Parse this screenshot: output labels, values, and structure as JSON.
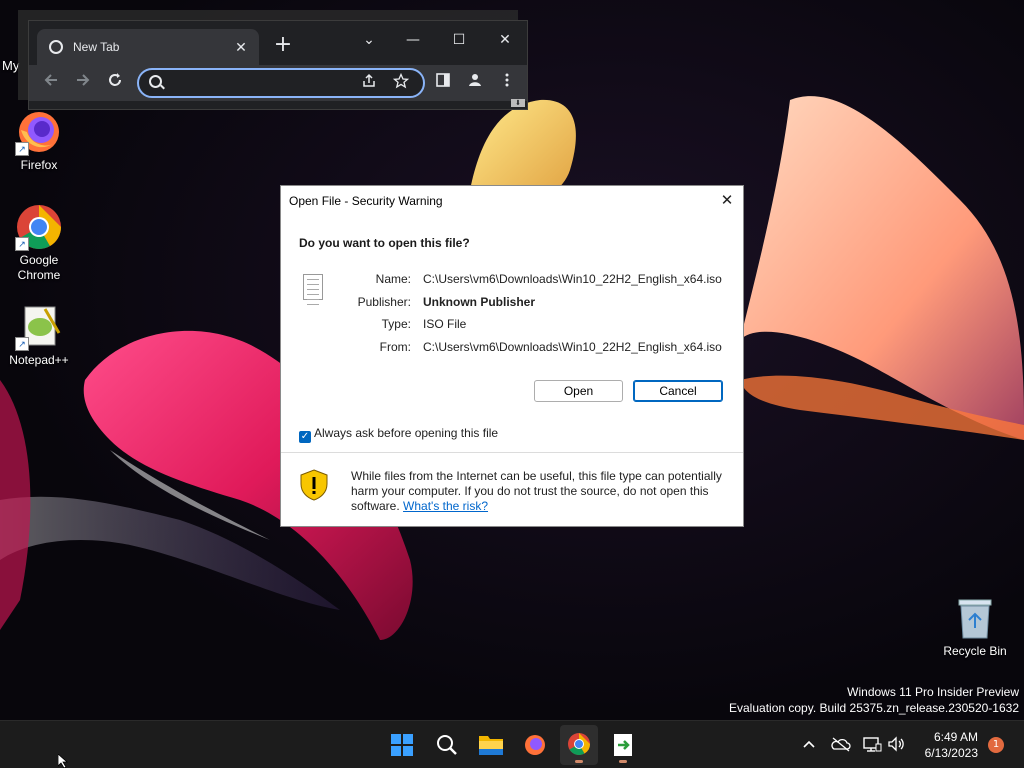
{
  "desktop": {
    "partial_label": "My",
    "icons": [
      {
        "label": "Firefox",
        "icon": "firefox-icon"
      },
      {
        "label": "Google\nChrome",
        "icon": "chrome-icon"
      },
      {
        "label": "Notepad++",
        "icon": "notepadpp-icon"
      }
    ],
    "recycle_bin": {
      "label": "Recycle Bin",
      "icon": "recycle-bin-icon"
    },
    "watermark": {
      "line1": "Windows 11 Pro Insider Preview",
      "line2": "Evaluation copy. Build 25375.zn_release.230520-1632"
    }
  },
  "browser": {
    "tab_title": "New Tab",
    "tab_close": "✕",
    "new_tab": "+",
    "controls": {
      "dropdown": "⌄",
      "minimize": "—",
      "maximize": "☐",
      "close": "✕"
    },
    "omnibox": {
      "value": "",
      "placeholder": ""
    },
    "toolbar_icons": [
      "back-icon",
      "forward-icon",
      "reload-icon",
      "share-icon",
      "star-icon",
      "side-panel-icon",
      "profile-icon",
      "menu-icon"
    ]
  },
  "dialog": {
    "title": "Open File - Security Warning",
    "close": "✕",
    "question": "Do you want to open this file?",
    "fields": {
      "name_label": "Name:",
      "name_value": "C:\\Users\\vm6\\Downloads\\Win10_22H2_English_x64.iso",
      "publisher_label": "Publisher:",
      "publisher_value": "Unknown Publisher",
      "type_label": "Type:",
      "type_value": "ISO File",
      "from_label": "From:",
      "from_value": "C:\\Users\\vm6\\Downloads\\Win10_22H2_English_x64.iso"
    },
    "open_button": "Open",
    "cancel_button": "Cancel",
    "checkbox_label": "Always ask before opening this file",
    "checkbox_checked": true,
    "warning_text": "While files from the Internet can be useful, this file type can potentially harm your computer. If you do not trust the source, do not open this software. ",
    "warning_link": "What's the risk?"
  },
  "taskbar": {
    "apps": [
      "start-icon",
      "search-icon",
      "file-explorer-icon",
      "firefox-icon",
      "chrome-icon",
      "app-installer-icon"
    ],
    "active_app": "chrome-icon",
    "tray": [
      "chevron-up-icon",
      "onedrive-icon",
      "network-icon",
      "volume-icon"
    ],
    "time": "6:49 AM",
    "date": "6/13/2023",
    "notification_count": "1"
  },
  "colors": {
    "accent": "#0067c0",
    "link": "#0066cc",
    "taskbar": "#1c1c1c",
    "chrome_dark": "#202124"
  }
}
